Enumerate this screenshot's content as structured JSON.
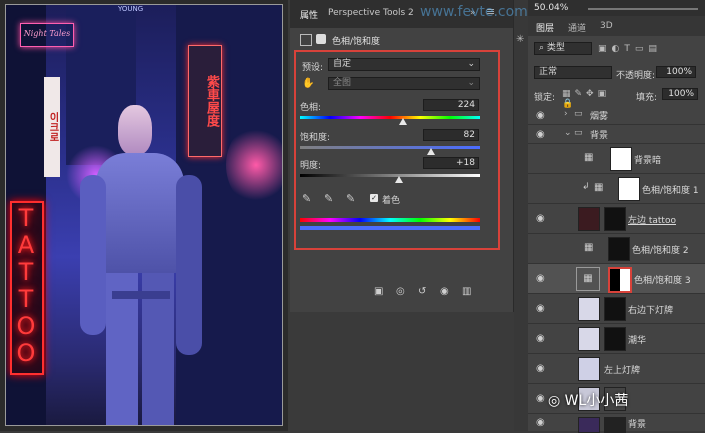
{
  "canvas": {
    "neon_sign_top": "Night Tales",
    "neon_sign_tattoo": "TATTOO",
    "sign_korean": "이크로",
    "sign_chinese": "紫車屋度",
    "top_fragment": "YOUNG"
  },
  "properties": {
    "tab_title": "属性",
    "tab_perspective": "Perspective Tools 2",
    "layer_type": "色相/饱和度",
    "preset_label": "预设:",
    "preset_value": "自定",
    "channel_value": "全图",
    "hue_label": "色相:",
    "hue_value": "224",
    "saturation_label": "饱和度:",
    "saturation_value": "82",
    "lightness_label": "明度:",
    "lightness_value": "+18",
    "colorize_label": "着色",
    "colorize_checked": true,
    "hue_fraction": 0.57,
    "saturation_fraction": 0.73,
    "lightness_fraction": 0.55
  },
  "layers": {
    "zoom": "50.04%",
    "tabs": [
      "图层",
      "通道",
      "3D"
    ],
    "filter_kind": "类型",
    "blend_mode": "正常",
    "opacity_label": "不透明度:",
    "opacity_value": "100%",
    "lock_label": "锁定:",
    "fill_label": "填充:",
    "fill_value": "100%",
    "items": [
      {
        "name": "烟雾",
        "kind": "group"
      },
      {
        "name": "背景",
        "kind": "group"
      },
      {
        "name": "背景暗",
        "kind": "adjust"
      },
      {
        "name": "色相/饱和度 1",
        "kind": "hue"
      },
      {
        "name": "左边 tattoo",
        "kind": "image"
      },
      {
        "name": "色相/饱和度 2",
        "kind": "hue"
      },
      {
        "name": "色相/饱和度 3",
        "kind": "hue"
      },
      {
        "name": "右边下灯牌",
        "kind": "image"
      },
      {
        "name": "潮华",
        "kind": "image"
      },
      {
        "name": "左上灯牌",
        "kind": "image"
      },
      {
        "name": "背景",
        "kind": "image"
      }
    ]
  },
  "watermark": {
    "site": "www.fevte.com",
    "author": "WL小小茜"
  },
  "colors": {
    "accent_red": "#d8423a",
    "panel_bg": "#424242"
  }
}
